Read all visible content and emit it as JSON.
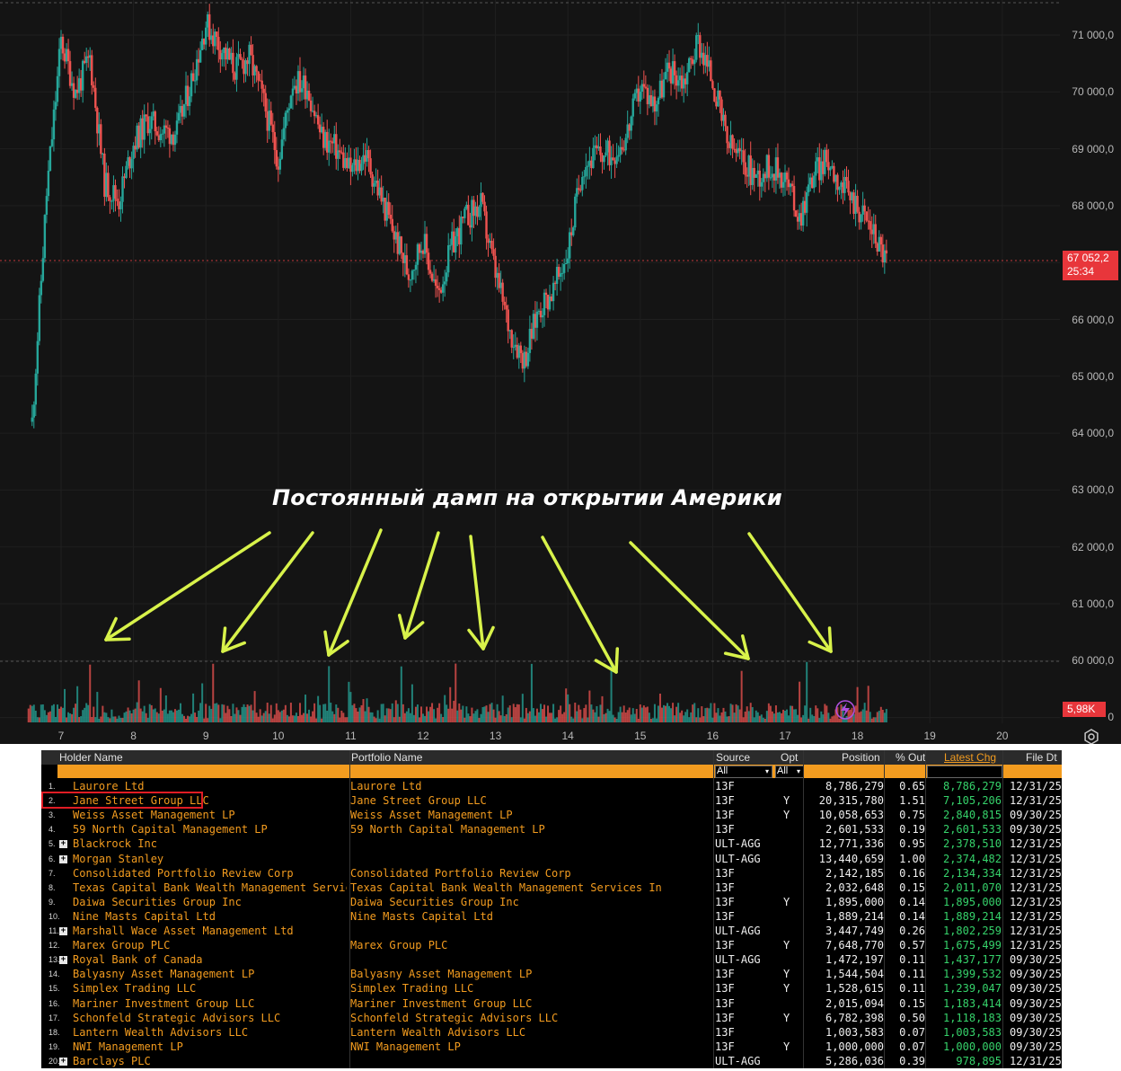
{
  "chart": {
    "y_axis_labels": [
      "71 000,0",
      "70 000,0",
      "69 000,0",
      "68 000,0",
      "67 000,0",
      "66 000,0",
      "65 000,0",
      "64 000,0",
      "63 000,0",
      "62 000,0",
      "61 000,0",
      "60 000,0"
    ],
    "y_axis_bottom": "0",
    "x_axis_labels": [
      "7",
      "8",
      "9",
      "10",
      "11",
      "12",
      "13",
      "14",
      "15",
      "16",
      "17",
      "18",
      "19",
      "20"
    ],
    "last_price": "67 052,2",
    "countdown": "25:34",
    "volume_badge": "5,98K",
    "annotation_text": "Постоянный дамп на открытии Америки",
    "colors": {
      "up": "#26a69a",
      "down": "#ef5350",
      "arrow": "#d8f24a",
      "badge": "#e8363b",
      "background": "#141414"
    }
  },
  "chart_data": {
    "type": "candlestick",
    "ylim": [
      59000,
      71500
    ],
    "x_ticks": [
      7,
      8,
      9,
      10,
      11,
      12,
      13,
      14,
      15,
      16,
      17,
      18,
      19,
      20
    ],
    "path_points": [
      [
        6.6,
        64200
      ],
      [
        6.8,
        68200
      ],
      [
        7.0,
        70900
      ],
      [
        7.2,
        70000
      ],
      [
        7.4,
        70600
      ],
      [
        7.6,
        68400
      ],
      [
        7.8,
        68100
      ],
      [
        8.0,
        69100
      ],
      [
        8.2,
        69500
      ],
      [
        8.4,
        69300
      ],
      [
        8.6,
        69300
      ],
      [
        8.8,
        70200
      ],
      [
        9.0,
        71200
      ],
      [
        9.2,
        70800
      ],
      [
        9.4,
        70400
      ],
      [
        9.6,
        70600
      ],
      [
        9.8,
        69800
      ],
      [
        10.0,
        68800
      ],
      [
        10.2,
        70200
      ],
      [
        10.4,
        70100
      ],
      [
        10.6,
        69200
      ],
      [
        10.8,
        69000
      ],
      [
        11.0,
        68600
      ],
      [
        11.2,
        68900
      ],
      [
        11.4,
        68200
      ],
      [
        11.6,
        67500
      ],
      [
        11.8,
        66800
      ],
      [
        12.0,
        67400
      ],
      [
        12.2,
        66400
      ],
      [
        12.4,
        67300
      ],
      [
        12.6,
        67800
      ],
      [
        12.8,
        68000
      ],
      [
        13.0,
        66800
      ],
      [
        13.2,
        65800
      ],
      [
        13.4,
        65300
      ],
      [
        13.6,
        66200
      ],
      [
        13.8,
        66500
      ],
      [
        14.0,
        67200
      ],
      [
        14.2,
        68700
      ],
      [
        14.4,
        68900
      ],
      [
        14.6,
        68900
      ],
      [
        14.8,
        69200
      ],
      [
        15.0,
        70100
      ],
      [
        15.2,
        69800
      ],
      [
        15.4,
        70400
      ],
      [
        15.6,
        70200
      ],
      [
        15.8,
        70900
      ],
      [
        16.0,
        70200
      ],
      [
        16.2,
        69100
      ],
      [
        16.4,
        68800
      ],
      [
        16.6,
        68500
      ],
      [
        16.8,
        68700
      ],
      [
        17.0,
        68500
      ],
      [
        17.2,
        67800
      ],
      [
        17.4,
        68600
      ],
      [
        17.6,
        68800
      ],
      [
        17.8,
        68300
      ],
      [
        18.0,
        68000
      ],
      [
        18.2,
        67600
      ],
      [
        18.4,
        67052
      ]
    ],
    "volume_spikes_x": [
      7.4,
      9.1,
      10.7,
      11.7,
      12.45,
      13.5,
      14.6,
      16.4,
      17.3
    ]
  },
  "table": {
    "headers": {
      "holder": "Holder Name",
      "portfolio": "Portfolio Name",
      "source": "Source",
      "opt": "Opt",
      "position": "Position",
      "out": "% Out",
      "latest_chg": "Latest Chg",
      "file_dt": "File Dt"
    },
    "filter": {
      "source": "All",
      "opt": "All"
    },
    "rows": [
      {
        "num": "1.",
        "exp": "",
        "holder": "Laurore Ltd",
        "portfolio": "Laurore Ltd",
        "source": "13F",
        "opt": "",
        "position": "8,786,279",
        "out": "0.65",
        "chg": "8,786,279",
        "dt": "12/31/25"
      },
      {
        "num": "2.",
        "exp": "",
        "holder": "Jane Street Group LLC",
        "portfolio": "Jane Street Group LLC",
        "source": "13F",
        "opt": "Y",
        "position": "20,315,780",
        "out": "1.51",
        "chg": "7,105,206",
        "dt": "12/31/25"
      },
      {
        "num": "3.",
        "exp": "",
        "holder": "Weiss Asset Management LP",
        "portfolio": "Weiss Asset Management LP",
        "source": "13F",
        "opt": "Y",
        "position": "10,058,653",
        "out": "0.75",
        "chg": "2,840,815",
        "dt": "09/30/25"
      },
      {
        "num": "4.",
        "exp": "",
        "holder": "59 North Capital Management LP",
        "portfolio": "59 North Capital Management LP",
        "source": "13F",
        "opt": "",
        "position": "2,601,533",
        "out": "0.19",
        "chg": "2,601,533",
        "dt": "09/30/25"
      },
      {
        "num": "5.",
        "exp": "+",
        "holder": "Blackrock Inc",
        "portfolio": "",
        "source": "ULT-AGG",
        "opt": "",
        "position": "12,771,336",
        "out": "0.95",
        "chg": "2,378,510",
        "dt": "12/31/25"
      },
      {
        "num": "6.",
        "exp": "+",
        "holder": "Morgan Stanley",
        "portfolio": "",
        "source": "ULT-AGG",
        "opt": "",
        "position": "13,440,659",
        "out": "1.00",
        "chg": "2,374,482",
        "dt": "12/31/25"
      },
      {
        "num": "7.",
        "exp": "",
        "holder": "Consolidated Portfolio Review Corp",
        "portfolio": "Consolidated Portfolio Review Corp",
        "source": "13F",
        "opt": "",
        "position": "2,142,185",
        "out": "0.16",
        "chg": "2,134,334",
        "dt": "12/31/25"
      },
      {
        "num": "8.",
        "exp": "",
        "holder": "Texas Capital Bank Wealth Management Services Inc",
        "portfolio": "Texas Capital Bank Wealth Management Services In",
        "source": "13F",
        "opt": "",
        "position": "2,032,648",
        "out": "0.15",
        "chg": "2,011,070",
        "dt": "12/31/25"
      },
      {
        "num": "9.",
        "exp": "",
        "holder": "Daiwa Securities Group Inc",
        "portfolio": "Daiwa Securities Group Inc",
        "source": "13F",
        "opt": "Y",
        "position": "1,895,000",
        "out": "0.14",
        "chg": "1,895,000",
        "dt": "12/31/25"
      },
      {
        "num": "10.",
        "exp": "",
        "holder": "Nine Masts Capital Ltd",
        "portfolio": "Nine Masts Capital Ltd",
        "source": "13F",
        "opt": "",
        "position": "1,889,214",
        "out": "0.14",
        "chg": "1,889,214",
        "dt": "12/31/25"
      },
      {
        "num": "11.",
        "exp": "+",
        "holder": "Marshall Wace Asset Management Ltd",
        "portfolio": "",
        "source": "ULT-AGG",
        "opt": "",
        "position": "3,447,749",
        "out": "0.26",
        "chg": "1,802,259",
        "dt": "12/31/25"
      },
      {
        "num": "12.",
        "exp": "",
        "holder": "Marex Group PLC",
        "portfolio": "Marex Group PLC",
        "source": "13F",
        "opt": "Y",
        "position": "7,648,770",
        "out": "0.57",
        "chg": "1,675,499",
        "dt": "12/31/25"
      },
      {
        "num": "13.",
        "exp": "+",
        "holder": "Royal Bank of Canada",
        "portfolio": "",
        "source": "ULT-AGG",
        "opt": "",
        "position": "1,472,197",
        "out": "0.11",
        "chg": "1,437,177",
        "dt": "09/30/25"
      },
      {
        "num": "14.",
        "exp": "",
        "holder": "Balyasny Asset Management LP",
        "portfolio": "Balyasny Asset Management LP",
        "source": "13F",
        "opt": "Y",
        "position": "1,544,504",
        "out": "0.11",
        "chg": "1,399,532",
        "dt": "09/30/25"
      },
      {
        "num": "15.",
        "exp": "",
        "holder": "Simplex Trading LLC",
        "portfolio": "Simplex Trading LLC",
        "source": "13F",
        "opt": "Y",
        "position": "1,528,615",
        "out": "0.11",
        "chg": "1,239,047",
        "dt": "09/30/25"
      },
      {
        "num": "16.",
        "exp": "",
        "holder": "Mariner Investment Group LLC",
        "portfolio": "Mariner Investment Group LLC",
        "source": "13F",
        "opt": "",
        "position": "2,015,094",
        "out": "0.15",
        "chg": "1,183,414",
        "dt": "09/30/25"
      },
      {
        "num": "17.",
        "exp": "",
        "holder": "Schonfeld Strategic Advisors LLC",
        "portfolio": "Schonfeld Strategic Advisors LLC",
        "source": "13F",
        "opt": "Y",
        "position": "6,782,398",
        "out": "0.50",
        "chg": "1,118,183",
        "dt": "09/30/25"
      },
      {
        "num": "18.",
        "exp": "",
        "holder": "Lantern Wealth Advisors LLC",
        "portfolio": "Lantern Wealth Advisors LLC",
        "source": "13F",
        "opt": "",
        "position": "1,003,583",
        "out": "0.07",
        "chg": "1,003,583",
        "dt": "09/30/25"
      },
      {
        "num": "19.",
        "exp": "",
        "holder": "NWI Management LP",
        "portfolio": "NWI Management LP",
        "source": "13F",
        "opt": "Y",
        "position": "1,000,000",
        "out": "0.07",
        "chg": "1,000,000",
        "dt": "09/30/25"
      },
      {
        "num": "20.",
        "exp": "+",
        "holder": "Barclays PLC",
        "portfolio": "",
        "source": "ULT-AGG",
        "opt": "",
        "position": "5,286,036",
        "out": "0.39",
        "chg": "978,895",
        "dt": "12/31/25"
      }
    ]
  }
}
